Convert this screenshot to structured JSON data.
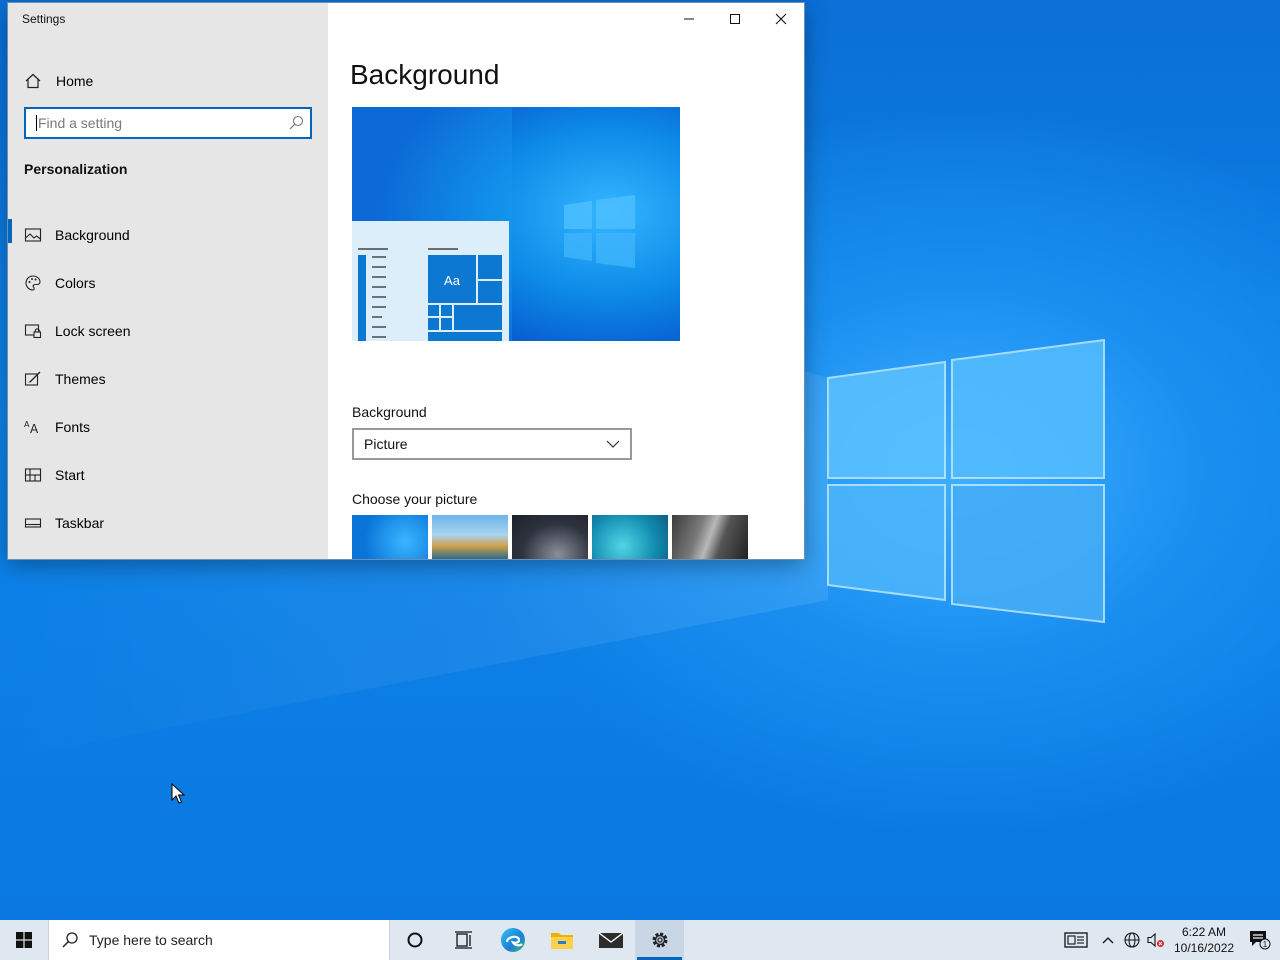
{
  "window": {
    "title": "Settings",
    "controls": [
      "minimize-icon",
      "maximize-icon",
      "close-icon"
    ]
  },
  "sidebar": {
    "home_label": "Home",
    "search_placeholder": "Find a setting",
    "section_title": "Personalization",
    "items": [
      {
        "label": "Background",
        "icon": "picture-icon",
        "active": true
      },
      {
        "label": "Colors",
        "icon": "palette-icon",
        "active": false
      },
      {
        "label": "Lock screen",
        "icon": "lock-screen-icon",
        "active": false
      },
      {
        "label": "Themes",
        "icon": "themes-icon",
        "active": false
      },
      {
        "label": "Fonts",
        "icon": "fonts-icon",
        "active": false
      },
      {
        "label": "Start",
        "icon": "start-icon",
        "active": false
      },
      {
        "label": "Taskbar",
        "icon": "taskbar-icon",
        "active": false
      }
    ]
  },
  "main": {
    "page_title": "Background",
    "preview_tile_text": "Aa",
    "background_label": "Background",
    "background_value": "Picture",
    "choose_picture_label": "Choose your picture"
  },
  "taskbar": {
    "search_placeholder": "Type here to search",
    "apps": [
      "cortana-icon",
      "task-view-icon",
      "edge-icon",
      "file-explorer-icon",
      "mail-icon",
      "settings-icon"
    ],
    "active_app": "settings-icon",
    "time": "6:22 AM",
    "date": "10/16/2022",
    "notification_count": "1"
  },
  "colors": {
    "accent": "#0067c0",
    "desktop": "#0a78e0",
    "sidebar_bg": "#e6e6e6",
    "taskbar_bg": "#dfe7f0"
  }
}
